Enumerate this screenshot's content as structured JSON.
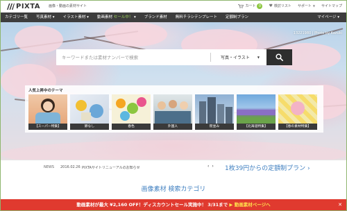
{
  "header": {
    "brand": "PIXTA",
    "tagline": "画像・動画の素材サイト",
    "cart_label": "カート",
    "cart_count": "0",
    "wishlist_label": "検討リスト",
    "support_label": "サポート",
    "sitemap_label": "サイトマップ"
  },
  "nav": {
    "items": [
      {
        "label": "カテゴリ一覧"
      },
      {
        "label": "写真素材 ▾"
      },
      {
        "label": "イラスト素材 ▾"
      },
      {
        "label": "動画素材",
        "highlight": "セール中！",
        "suffix": " ▾"
      },
      {
        "label": "ブランド素材"
      },
      {
        "label": "無料チラシテンプレート"
      },
      {
        "label": "定額制プラン"
      }
    ],
    "mypage_label": "マイページ ▾"
  },
  "hero": {
    "photo_credit": "13221980 | Photo by Kazuki"
  },
  "search": {
    "placeholder": "キーワードまたは素材ナンバーで検索",
    "type_selected": "写真・イラスト",
    "icons": {
      "submit": "search-icon",
      "dropdown": "caret-down-icon"
    }
  },
  "themes": {
    "title": "人気上昇中のテーマ",
    "items": [
      {
        "label": "【スーパー特集】"
      },
      {
        "label": "節なし"
      },
      {
        "label": "春色"
      },
      {
        "label": "外国人"
      },
      {
        "label": "街並み"
      },
      {
        "label": "【北海道特集】"
      },
      {
        "label": "【春の素材特集】"
      }
    ]
  },
  "news": {
    "label": "NEWS",
    "date": "2016.02.26",
    "text": "PIXTAサイトリニューアルのお知らせ",
    "prev": "‹",
    "next": "›",
    "promo": "1枚39円からの定額制プラン ›"
  },
  "category": {
    "title": "画像素材 検索カテゴリ"
  },
  "banner": {
    "text": "動画素材が最大 ¥2,160 OFF！ディスカウントセール実施中！ 3/31まで",
    "link": " ▶ 動画素材ページへ",
    "close": "✕"
  },
  "colors": {
    "nav_bg": "#3d3d3d",
    "accent_green": "#8cc63f",
    "link_blue": "#3f7fc0",
    "banner_red": "#e03a2f"
  }
}
